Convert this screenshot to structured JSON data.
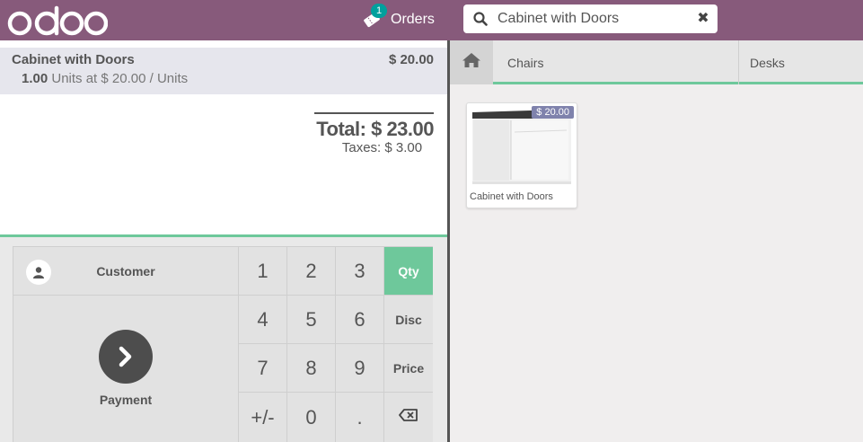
{
  "header": {
    "logo_text": "odoo",
    "orders_label": "Orders",
    "orders_count": "1",
    "search_value": "Cabinet with Doors",
    "clear_symbol": "✖"
  },
  "order": {
    "line": {
      "product_name": "Cabinet with Doors",
      "price": "$ 20.00",
      "quantity": "1.00",
      "unit_info": "Units at $ 20.00 / Units"
    },
    "total": "Total: $ 23.00",
    "taxes": "Taxes: $ 3.00"
  },
  "actionpad": {
    "customer_label": "Customer",
    "payment_label": "Payment"
  },
  "numpad": {
    "keys": [
      "1",
      "2",
      "3",
      "4",
      "5",
      "6",
      "7",
      "8",
      "9",
      "+/-",
      "0",
      "."
    ],
    "modes": [
      "Qty",
      "Disc",
      "Price"
    ],
    "active_mode": "Qty"
  },
  "categories": {
    "items": [
      "Chairs",
      "Desks"
    ]
  },
  "products": [
    {
      "name": "Cabinet with Doors",
      "price": "$ 20.00"
    }
  ],
  "colors": {
    "header_bg": "#875a7b",
    "accent_green": "#6ec89b",
    "badge_teal": "#00a09d",
    "price_tag": "#7f82ac",
    "payment_circle": "#4d4d4d"
  }
}
